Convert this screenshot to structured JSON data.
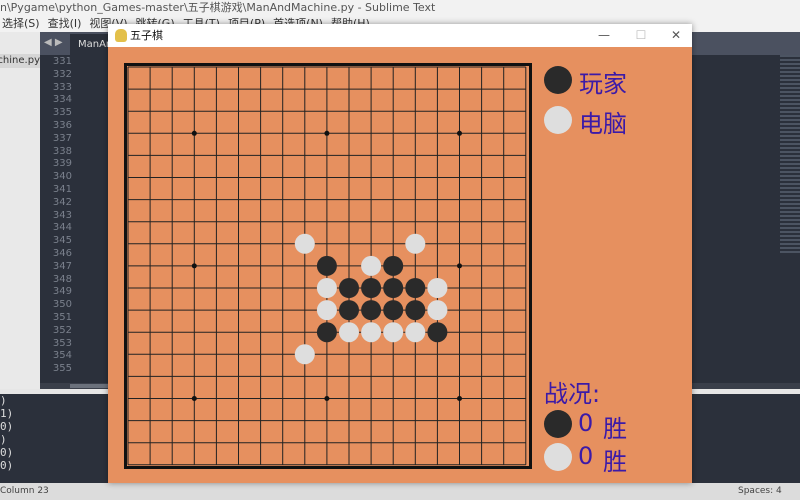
{
  "editor": {
    "title": "n\\Pygame\\python_Games-master\\五子棋游戏\\ManAndMachine.py - Sublime Text",
    "menu": [
      "选择(S)",
      "查找(I)",
      "视图(V)",
      "跳转(G)",
      "工具(T)",
      "项目(P)",
      "首选项(N)",
      "帮助(H)"
    ],
    "sidebar_file": "ManAndMachine.py",
    "tab": "ManAndMachine.py",
    "line_numbers": [
      "331",
      "332",
      "333",
      "334",
      "335",
      "336",
      "337",
      "338",
      "339",
      "340",
      "341",
      "342",
      "343",
      "344",
      "345",
      "346",
      "347",
      "348",
      "349",
      "350",
      "351",
      "352",
      "353",
      "354",
      "355"
    ],
    "console_lines": [
      ")",
      "1)",
      "0)",
      ")",
      "0)",
      "0)"
    ],
    "status_left": "Column 23",
    "status_right": "Spaces: 4"
  },
  "game": {
    "title": "五子棋",
    "controls": {
      "minimize": "—",
      "maximize": "☐",
      "close": "✕"
    },
    "board_size": 19,
    "star_points": [
      [
        3,
        3
      ],
      [
        3,
        9
      ],
      [
        3,
        15
      ],
      [
        9,
        3
      ],
      [
        9,
        9
      ],
      [
        9,
        15
      ],
      [
        15,
        3
      ],
      [
        15,
        9
      ],
      [
        15,
        15
      ]
    ],
    "stones": [
      {
        "row": 8,
        "col": 8,
        "color": "white"
      },
      {
        "row": 8,
        "col": 13,
        "color": "white"
      },
      {
        "row": 9,
        "col": 9,
        "color": "black"
      },
      {
        "row": 9,
        "col": 11,
        "color": "white"
      },
      {
        "row": 9,
        "col": 12,
        "color": "black"
      },
      {
        "row": 10,
        "col": 9,
        "color": "white"
      },
      {
        "row": 10,
        "col": 10,
        "color": "black"
      },
      {
        "row": 10,
        "col": 11,
        "color": "black"
      },
      {
        "row": 10,
        "col": 12,
        "color": "black"
      },
      {
        "row": 10,
        "col": 13,
        "color": "black"
      },
      {
        "row": 10,
        "col": 14,
        "color": "white"
      },
      {
        "row": 11,
        "col": 9,
        "color": "white"
      },
      {
        "row": 11,
        "col": 10,
        "color": "black"
      },
      {
        "row": 11,
        "col": 11,
        "color": "black"
      },
      {
        "row": 11,
        "col": 12,
        "color": "black"
      },
      {
        "row": 11,
        "col": 13,
        "color": "black"
      },
      {
        "row": 11,
        "col": 14,
        "color": "white"
      },
      {
        "row": 12,
        "col": 9,
        "color": "black"
      },
      {
        "row": 12,
        "col": 10,
        "color": "white"
      },
      {
        "row": 12,
        "col": 11,
        "color": "white"
      },
      {
        "row": 12,
        "col": 12,
        "color": "white"
      },
      {
        "row": 12,
        "col": 13,
        "color": "white"
      },
      {
        "row": 12,
        "col": 14,
        "color": "black"
      },
      {
        "row": 13,
        "col": 8,
        "color": "white"
      }
    ],
    "player_label": "玩家",
    "computer_label": "电脑",
    "record_title": "战况:",
    "player_wins": "0",
    "computer_wins": "0",
    "win_label": "胜",
    "colors": {
      "board": "#e6905f",
      "text": "#3b1aa8",
      "black": "#2a2a2a",
      "white": "#dedede"
    }
  }
}
